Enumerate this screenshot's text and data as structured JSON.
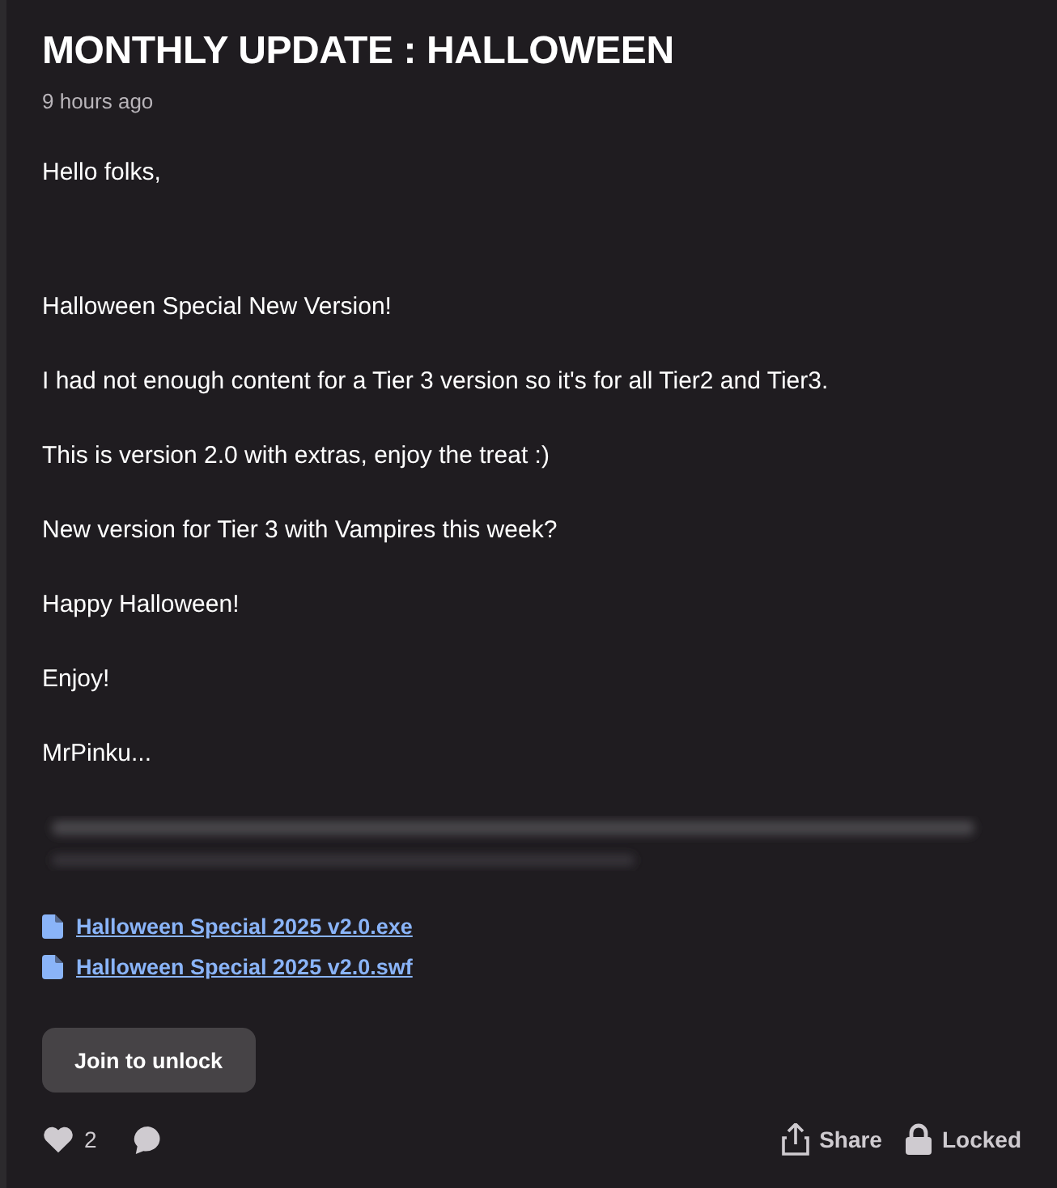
{
  "post": {
    "title": "MONTHLY UPDATE : HALLOWEEN",
    "time": "9 hours ago"
  },
  "greeting": "Hello folks,",
  "paragraphs": [
    "Halloween Special New Version!",
    "I had not enough content for a Tier 3 version so it's for all Tier2 and Tier3.",
    "This is version 2.0 with extras, enjoy the treat :)",
    "New version for Tier 3 with Vampires this week?",
    "Happy Halloween!",
    "Enjoy!",
    "MrPinku..."
  ],
  "attachments": [
    {
      "name": "Halloween Special 2025 v2.0.exe"
    },
    {
      "name": "Halloween Special 2025 v2.0.swf"
    }
  ],
  "unlock_button": "Join to unlock",
  "footer": {
    "likes": "2",
    "share": "Share",
    "locked": "Locked"
  }
}
